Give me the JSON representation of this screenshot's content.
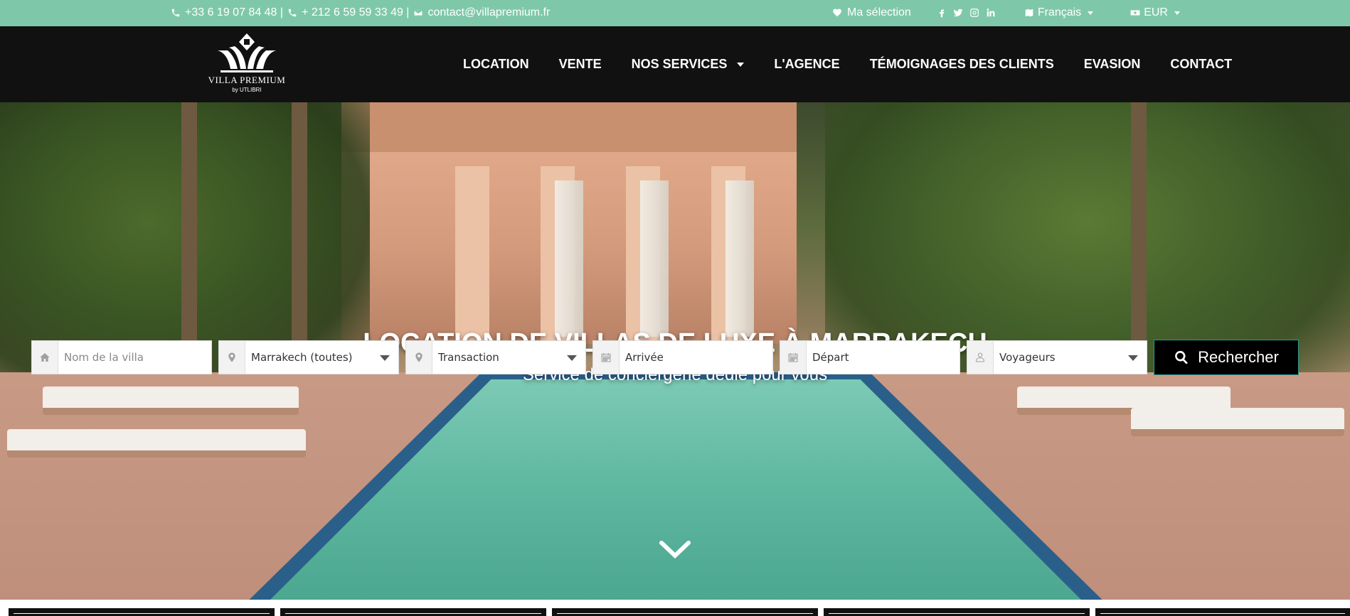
{
  "topbar": {
    "phone1": "+33 6 19 07 84 48 |",
    "phone2": "+ 212 6 59 59 33 49 |",
    "email": "contact@villapremium.fr",
    "selection": "Ma sélection",
    "language": "Français",
    "currency": "EUR",
    "socials": [
      "facebook-icon",
      "twitter-icon",
      "instagram-icon",
      "linkedin-icon"
    ]
  },
  "logo": {
    "name": "VILLA PREMIUM",
    "by": "by UTLIBRI"
  },
  "nav": {
    "items": [
      "LOCATION",
      "VENTE",
      "NOS SERVICES",
      "L'AGENCE",
      "TÉMOIGNAGES DES CLIENTS",
      "EVASION",
      "CONTACT"
    ]
  },
  "hero": {
    "title": "LOCATION DE VILLAS DE LUXE À MARRAKECH",
    "subtitle": "Service de conciergerie dédié pour vous"
  },
  "search": {
    "villa_placeholder": "Nom de la villa",
    "location": "Marrakech (toutes)",
    "transaction": "Transaction",
    "arrival": "Arrivée",
    "departure": "Départ",
    "guests": "Voyageurs",
    "button": "Rechercher"
  },
  "colors": {
    "topbar": "#7ec8a9",
    "header": "#111111",
    "button_border": "#2a9d8f"
  }
}
